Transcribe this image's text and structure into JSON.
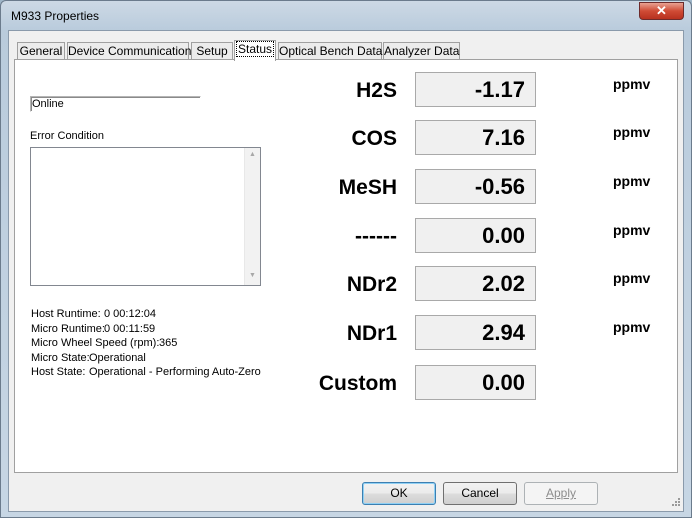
{
  "window": {
    "title": "M933 Properties",
    "close_glyph": "✕"
  },
  "tabs": [
    {
      "label": "General"
    },
    {
      "label": "Device Communication"
    },
    {
      "label": "Setup"
    },
    {
      "label": "Status",
      "active": true
    },
    {
      "label": "Optical Bench Data"
    },
    {
      "label": "Analyzer Data"
    }
  ],
  "status": {
    "connection": "Online",
    "error_label": "Error Condition",
    "error_text": "",
    "info": [
      {
        "label": "Host Runtime:",
        "value": "0 00:12:04"
      },
      {
        "label": "Micro Runtime:",
        "value": "0 00:11:59"
      },
      {
        "label": "Micro Wheel Speed (rpm):",
        "value": "365"
      },
      {
        "label": "Micro State:",
        "value": "Operational"
      },
      {
        "label": "Host State:",
        "value": "Operational - Performing Auto-Zero"
      }
    ]
  },
  "measurements": [
    {
      "name": "H2S",
      "value": "-1.17",
      "unit": "ppmv"
    },
    {
      "name": "COS",
      "value": "7.16",
      "unit": "ppmv"
    },
    {
      "name": "MeSH",
      "value": "-0.56",
      "unit": "ppmv"
    },
    {
      "name": "------",
      "value": "0.00",
      "unit": "ppmv"
    },
    {
      "name": "NDr2",
      "value": "2.02",
      "unit": "ppmv"
    },
    {
      "name": "NDr1",
      "value": "2.94",
      "unit": "ppmv"
    },
    {
      "name": "Custom",
      "value": "0.00",
      "unit": ""
    }
  ],
  "buttons": {
    "ok": "OK",
    "cancel": "Cancel",
    "apply": "Apply"
  },
  "icons": {
    "close": "close-icon",
    "scroll_up": "scroll-up-arrow-icon",
    "scroll_down": "scroll-down-arrow-icon"
  }
}
